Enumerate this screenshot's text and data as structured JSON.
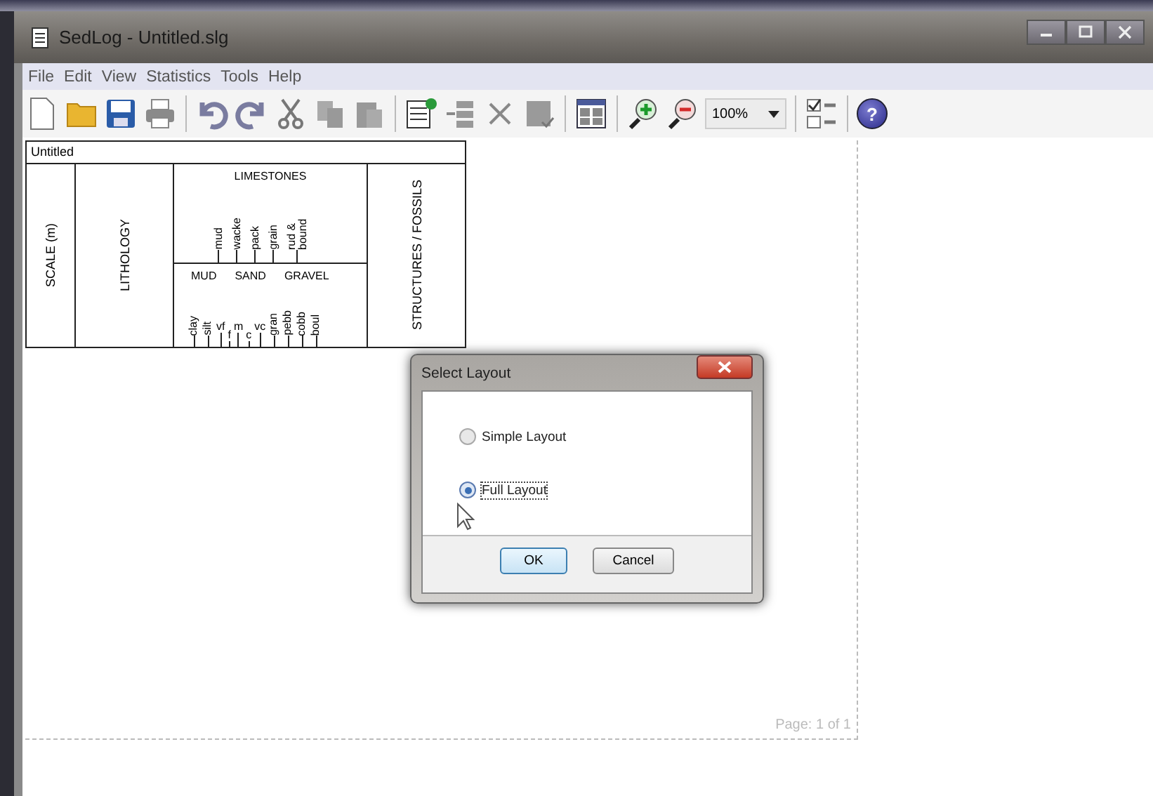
{
  "window": {
    "title": "SedLog - Untitled.slg"
  },
  "menu": [
    "File",
    "Edit",
    "View",
    "Statistics",
    "Tools",
    "Help"
  ],
  "toolbar": {
    "zoom": "100%",
    "help": "?"
  },
  "log_header": {
    "title": "Untitled",
    "scale": "SCALE (m)",
    "lithology": "LITHOLOGY",
    "limestones": {
      "heading": "LIMESTONES",
      "classes": [
        "mud",
        "wacke",
        "pack",
        "grain",
        "rud & bound"
      ]
    },
    "grain_size": {
      "groups": [
        "MUD",
        "SAND",
        "GRAVEL"
      ],
      "classes": [
        {
          "label": "clay",
          "kind": "vertical"
        },
        {
          "label": "silt",
          "kind": "vertical"
        },
        {
          "label": "vf",
          "kind": "upright"
        },
        {
          "label": "f",
          "kind": "upright-low"
        },
        {
          "label": "m",
          "kind": "upright"
        },
        {
          "label": "c",
          "kind": "upright-low"
        },
        {
          "label": "vc",
          "kind": "upright"
        },
        {
          "label": "gran",
          "kind": "vertical"
        },
        {
          "label": "pebb",
          "kind": "vertical"
        },
        {
          "label": "cobb",
          "kind": "vertical"
        },
        {
          "label": "boul",
          "kind": "vertical"
        }
      ]
    },
    "structures": "STRUCTURES / FOSSILS"
  },
  "dialog": {
    "title": "Select Layout",
    "options": [
      {
        "label": "Simple Layout",
        "selected": false
      },
      {
        "label": "Full Layout",
        "selected": true
      }
    ],
    "buttons": [
      "OK",
      "Cancel"
    ]
  },
  "page_label": "Page: 1 of 1"
}
